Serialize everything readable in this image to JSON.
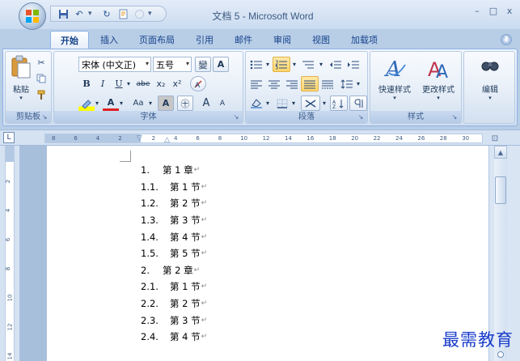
{
  "window": {
    "title": "文档 5 - Microsoft Word",
    "controls": {
      "minimize": "–",
      "maximize": "□",
      "close": "x"
    }
  },
  "quick_access": {
    "icons": [
      "save-icon",
      "undo-icon",
      "redo-icon",
      "format-painter-icon",
      "customize-icon"
    ]
  },
  "tabs": [
    {
      "label": "开始",
      "active": true
    },
    {
      "label": "插入"
    },
    {
      "label": "页面布局"
    },
    {
      "label": "引用"
    },
    {
      "label": "邮件"
    },
    {
      "label": "审阅"
    },
    {
      "label": "视图"
    },
    {
      "label": "加载项"
    }
  ],
  "ribbon": {
    "clipboard": {
      "label": "剪贴板",
      "paste_label": "粘贴"
    },
    "font": {
      "label": "字体",
      "font_name": "宋体 (中文正)",
      "font_size": "五号",
      "bold": "B",
      "italic": "I",
      "underline": "U",
      "strikethrough": "abe",
      "subscript": "x₂",
      "superscript": "x²",
      "font_color": "A",
      "change_case": "Aa",
      "char_shading": "A",
      "enclose_char": "㊉",
      "grow_font": "A",
      "shrink_font": "A",
      "phonetic": "變",
      "char_border": "A"
    },
    "paragraph": {
      "label": "段落"
    },
    "styles": {
      "label": "样式",
      "quick_styles": "快速样式",
      "change_styles": "更改样式"
    },
    "editing": {
      "label": "编辑"
    }
  },
  "ruler": {
    "numbers": [
      "8",
      "6",
      "4",
      "2",
      "2",
      "4",
      "6",
      "8",
      "10",
      "12",
      "14",
      "16",
      "18",
      "20",
      "22",
      "24",
      "26",
      "28",
      "30"
    ],
    "vertical_numbers": [
      "2",
      "4",
      "6",
      "8",
      "10",
      "12",
      "14"
    ]
  },
  "document": {
    "list": [
      {
        "num": "1.",
        "text": "第 1 章"
      },
      {
        "num": "1.1.",
        "text": "第 1 节"
      },
      {
        "num": "1.2.",
        "text": "第 2 节"
      },
      {
        "num": "1.3.",
        "text": "第 3 节"
      },
      {
        "num": "1.4.",
        "text": "第 4 节"
      },
      {
        "num": "1.5.",
        "text": "第 5 节"
      },
      {
        "num": "2.",
        "text": "第 2 章"
      },
      {
        "num": "2.1.",
        "text": "第 1 节"
      },
      {
        "num": "2.2.",
        "text": "第 2 节"
      },
      {
        "num": "2.3.",
        "text": "第 3 节"
      },
      {
        "num": "2.4.",
        "text": "第 4 节"
      }
    ],
    "paragraph_mark": "↵"
  },
  "watermark": "最需教育",
  "colors": {
    "ribbon_bg": "#dfe9f5",
    "tab_text": "#15428b",
    "highlight": "#ffd56b",
    "watermark": "#1a3dcc"
  }
}
